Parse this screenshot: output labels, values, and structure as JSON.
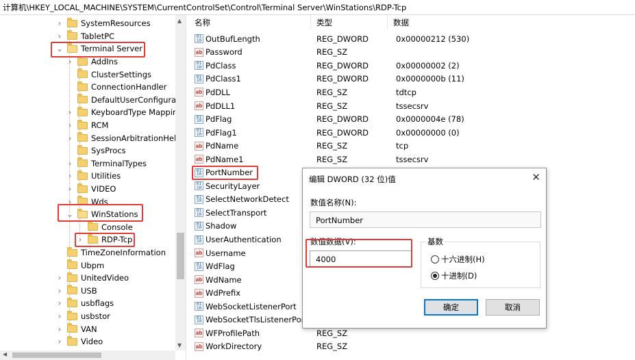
{
  "address": "计算机\\HKEY_LOCAL_MACHINE\\SYSTEM\\CurrentControlSet\\Control\\Terminal Server\\WinStations\\RDP-Tcp",
  "tree": {
    "items": [
      {
        "label": "SystemResources",
        "indent": 1,
        "expanded": false
      },
      {
        "label": "TabletPC",
        "indent": 1,
        "expanded": false
      },
      {
        "label": "Terminal Server",
        "indent": 1,
        "expanded": true
      },
      {
        "label": "AddIns",
        "indent": 2,
        "expanded": false
      },
      {
        "label": "ClusterSettings",
        "indent": 2,
        "expanded": null
      },
      {
        "label": "ConnectionHandler",
        "indent": 2,
        "expanded": null
      },
      {
        "label": "DefaultUserConfiguratio",
        "indent": 2,
        "expanded": null
      },
      {
        "label": "KeyboardType Mappin",
        "indent": 2,
        "expanded": false
      },
      {
        "label": "RCM",
        "indent": 2,
        "expanded": false
      },
      {
        "label": "SessionArbitrationHelpe",
        "indent": 2,
        "expanded": false
      },
      {
        "label": "SysProcs",
        "indent": 2,
        "expanded": null
      },
      {
        "label": "TerminalTypes",
        "indent": 2,
        "expanded": false
      },
      {
        "label": "Utilities",
        "indent": 2,
        "expanded": false
      },
      {
        "label": "VIDEO",
        "indent": 2,
        "expanded": false
      },
      {
        "label": "Wds",
        "indent": 2,
        "expanded": false
      },
      {
        "label": "WinStations",
        "indent": 2,
        "expanded": true
      },
      {
        "label": "Console",
        "indent": 3,
        "expanded": null
      },
      {
        "label": "RDP-Tcp",
        "indent": 3,
        "expanded": false
      },
      {
        "label": "TimeZoneInformation",
        "indent": 1,
        "expanded": null
      },
      {
        "label": "Ubpm",
        "indent": 1,
        "expanded": null
      },
      {
        "label": "UnitedVideo",
        "indent": 1,
        "expanded": false
      },
      {
        "label": "USB",
        "indent": 1,
        "expanded": false
      },
      {
        "label": "usbflags",
        "indent": 1,
        "expanded": false
      },
      {
        "label": "usbstor",
        "indent": 1,
        "expanded": false
      },
      {
        "label": "VAN",
        "indent": 1,
        "expanded": false
      },
      {
        "label": "Video",
        "indent": 1,
        "expanded": false
      }
    ]
  },
  "list": {
    "headers": {
      "name": "名称",
      "type": "类型",
      "data": "数据"
    },
    "rows": [
      {
        "name": "OutBufLength",
        "type": "REG_DWORD",
        "data": "0x00000212 (530)",
        "kind": "dword"
      },
      {
        "name": "Password",
        "type": "REG_SZ",
        "data": "",
        "kind": "sz"
      },
      {
        "name": "PdClass",
        "type": "REG_DWORD",
        "data": "0x00000002 (2)",
        "kind": "dword"
      },
      {
        "name": "PdClass1",
        "type": "REG_DWORD",
        "data": "0x0000000b (11)",
        "kind": "dword"
      },
      {
        "name": "PdDLL",
        "type": "REG_SZ",
        "data": "tdtcp",
        "kind": "sz"
      },
      {
        "name": "PdDLL1",
        "type": "REG_SZ",
        "data": "tssecsrv",
        "kind": "sz"
      },
      {
        "name": "PdFlag",
        "type": "REG_DWORD",
        "data": "0x0000004e (78)",
        "kind": "dword"
      },
      {
        "name": "PdFlag1",
        "type": "REG_DWORD",
        "data": "0x00000000 (0)",
        "kind": "dword"
      },
      {
        "name": "PdName",
        "type": "REG_SZ",
        "data": "tcp",
        "kind": "sz"
      },
      {
        "name": "PdName1",
        "type": "REG_SZ",
        "data": "tssecsrv",
        "kind": "sz"
      },
      {
        "name": "PortNumber",
        "type": "",
        "data": "",
        "kind": "dword"
      },
      {
        "name": "SecurityLayer",
        "type": "",
        "data": "",
        "kind": "dword"
      },
      {
        "name": "SelectNetworkDetect",
        "type": "",
        "data": "",
        "kind": "dword"
      },
      {
        "name": "SelectTransport",
        "type": "",
        "data": "",
        "kind": "dword"
      },
      {
        "name": "Shadow",
        "type": "",
        "data": "",
        "kind": "dword"
      },
      {
        "name": "UserAuthentication",
        "type": "",
        "data": "",
        "kind": "dword"
      },
      {
        "name": "Username",
        "type": "",
        "data": "",
        "kind": "sz"
      },
      {
        "name": "WdFlag",
        "type": "",
        "data": "",
        "kind": "dword"
      },
      {
        "name": "WdName",
        "type": "",
        "data": "",
        "kind": "sz"
      },
      {
        "name": "WdPrefix",
        "type": "",
        "data": "",
        "kind": "sz"
      },
      {
        "name": "WebSocketListenerPort",
        "type": "",
        "data": "",
        "kind": "dword"
      },
      {
        "name": "WebSocketTlsListenerPort",
        "type": "",
        "data": "",
        "kind": "dword"
      },
      {
        "name": "WFProfilePath",
        "type": "REG_SZ",
        "data": "",
        "kind": "sz"
      },
      {
        "name": "WorkDirectory",
        "type": "REG_SZ",
        "data": "",
        "kind": "sz"
      }
    ]
  },
  "dialog": {
    "title": "编辑 DWORD (32 位)值",
    "value_name_label": "数值名称(N):",
    "value_name": "PortNumber",
    "value_data_label": "数值数据(V):",
    "value_data": "4000",
    "base_label": "基数",
    "radio_hex": "十六进制(H)",
    "radio_dec": "十进制(D)",
    "selected_base": "dec",
    "ok_label": "确定",
    "cancel_label": "取消",
    "close_glyph": "✕"
  },
  "colors": {
    "highlight": "#e53935",
    "focus": "#0078d7"
  },
  "icons": {
    "dword": "binary-value-icon",
    "sz": "string-value-icon",
    "folder": "folder-icon"
  }
}
